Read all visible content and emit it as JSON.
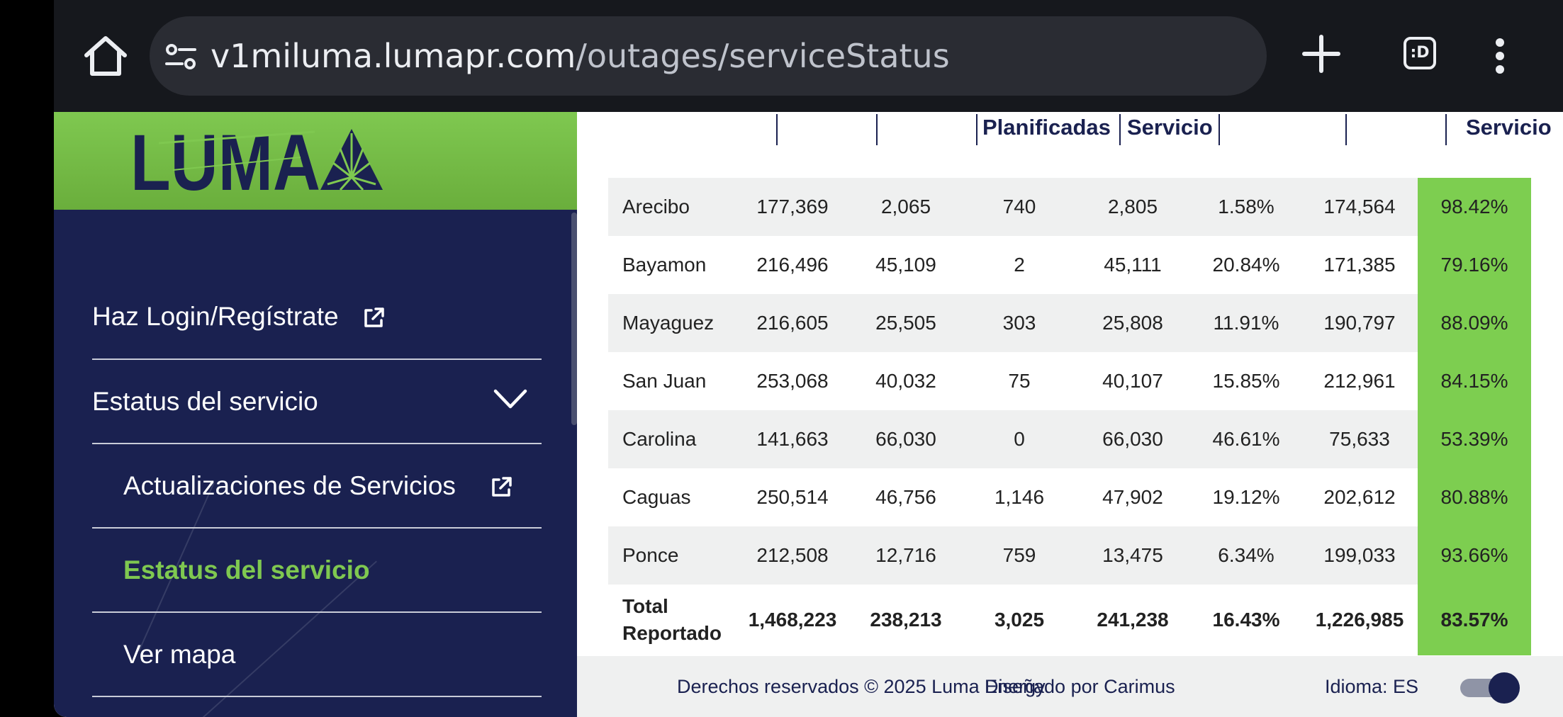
{
  "browser": {
    "url_host": "v1miluma.lumapr.com",
    "url_path": "/outages/serviceStatus",
    "tabs_label": ":D"
  },
  "colors": {
    "sidebar_bg": "#1a2150",
    "brand_green": "#7fc850",
    "service_pct_bg": "#7dce50",
    "active_nav": "#7fc850"
  },
  "sidebar": {
    "logo_text": "LUMA",
    "items": [
      {
        "label": "Haz Login/Regístrate",
        "icon": "external-link-icon"
      },
      {
        "label": "Estatus del servicio",
        "icon": "chevron-down-icon"
      },
      {
        "label": "Actualizaciones de Servicios",
        "icon": "external-link-icon"
      },
      {
        "label": "Estatus del servicio",
        "active": true
      },
      {
        "label": "Ver mapa"
      }
    ]
  },
  "table": {
    "header_fragments": [
      "Planificadas",
      "Servicio",
      "Servicio"
    ],
    "rows": [
      {
        "region": "Arecibo",
        "c1": "177,369",
        "c2": "2,065",
        "c3": "740",
        "c4": "2,805",
        "c5": "1.58%",
        "c6": "174,564",
        "c7": "98.42%"
      },
      {
        "region": "Bayamon",
        "c1": "216,496",
        "c2": "45,109",
        "c3": "2",
        "c4": "45,111",
        "c5": "20.84%",
        "c6": "171,385",
        "c7": "79.16%"
      },
      {
        "region": "Mayaguez",
        "c1": "216,605",
        "c2": "25,505",
        "c3": "303",
        "c4": "25,808",
        "c5": "11.91%",
        "c6": "190,797",
        "c7": "88.09%"
      },
      {
        "region": "San Juan",
        "c1": "253,068",
        "c2": "40,032",
        "c3": "75",
        "c4": "40,107",
        "c5": "15.85%",
        "c6": "212,961",
        "c7": "84.15%"
      },
      {
        "region": "Carolina",
        "c1": "141,663",
        "c2": "66,030",
        "c3": "0",
        "c4": "66,030",
        "c5": "46.61%",
        "c6": "75,633",
        "c7": "53.39%"
      },
      {
        "region": "Caguas",
        "c1": "250,514",
        "c2": "46,756",
        "c3": "1,146",
        "c4": "47,902",
        "c5": "19.12%",
        "c6": "202,612",
        "c7": "80.88%"
      },
      {
        "region": "Ponce",
        "c1": "212,508",
        "c2": "12,716",
        "c3": "759",
        "c4": "13,475",
        "c5": "6.34%",
        "c6": "199,033",
        "c7": "93.66%"
      }
    ],
    "total": {
      "region": "Total Reportado",
      "c1": "1,468,223",
      "c2": "238,213",
      "c3": "3,025",
      "c4": "241,238",
      "c5": "16.43%",
      "c6": "1,226,985",
      "c7": "83.57%"
    }
  },
  "footer": {
    "copyright": "Derechos reservados © 2025 Luma Energy",
    "designed_by": "Diseñado por Carimus",
    "language": "Idioma: ES"
  }
}
